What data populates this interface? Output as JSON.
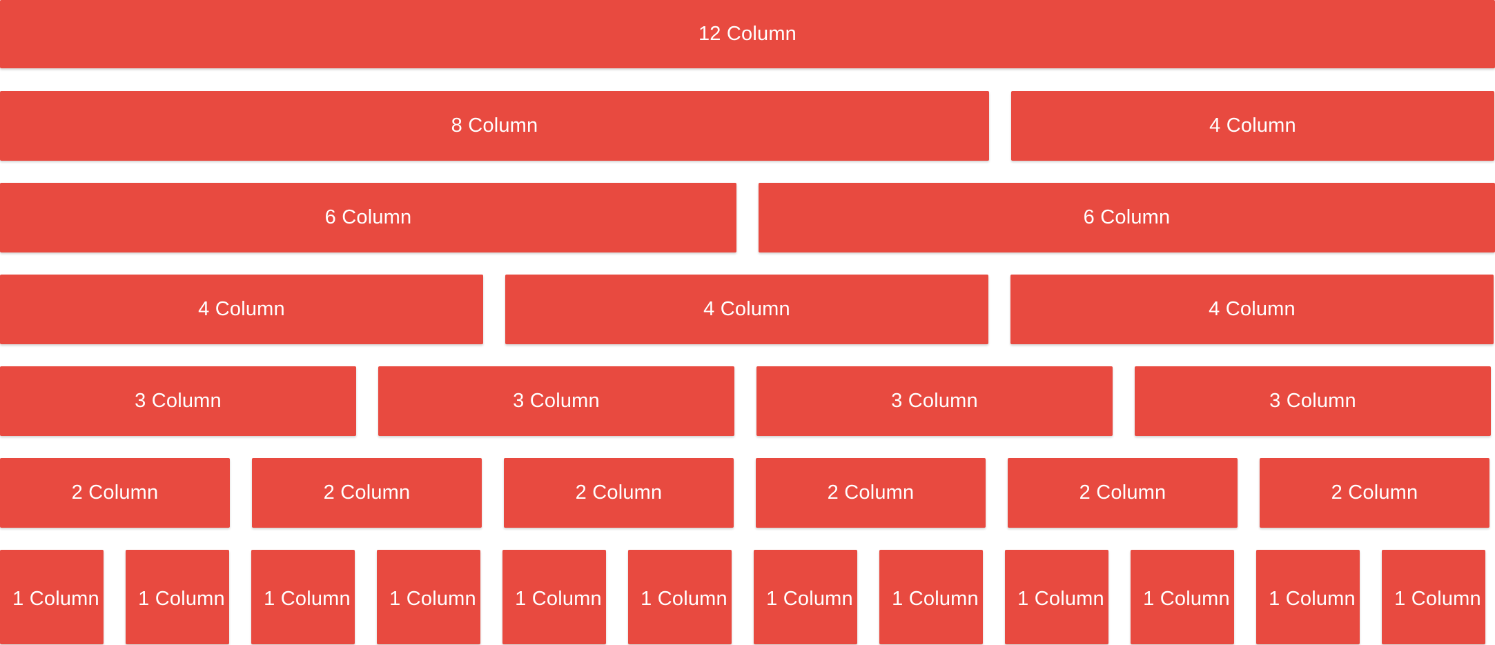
{
  "grid": {
    "row12": [
      "12 Column"
    ],
    "row8_4": [
      "8 Column",
      "4 Column"
    ],
    "row6": [
      "6 Column",
      "6 Column"
    ],
    "row4": [
      "4 Column",
      "4 Column",
      "4 Column"
    ],
    "row3": [
      "3 Column",
      "3 Column",
      "3 Column",
      "3 Column"
    ],
    "row2": [
      "2 Column",
      "2 Column",
      "2 Column",
      "2 Column",
      "2 Column",
      "2 Column"
    ],
    "row1": [
      "1 Column",
      "1 Column",
      "1 Column",
      "1 Column",
      "1 Column",
      "1 Column",
      "1 Column",
      "1 Column",
      "1 Column",
      "1 Column",
      "1 Column",
      "1 Column"
    ]
  },
  "colors": {
    "cell_background": "#e84a40",
    "cell_text": "#ffffff"
  }
}
